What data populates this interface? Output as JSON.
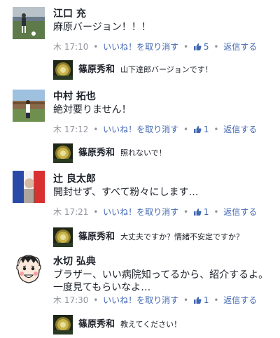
{
  "ui": {
    "link_color": "#4267b2",
    "meta_color": "#90949c",
    "like_icon": "thumbs-up-icon"
  },
  "comments": [
    {
      "author": "江口 充",
      "text_lines": [
        "麻原バージョン！！！"
      ],
      "day": "木",
      "time": "17:10",
      "unlike_label": "いいね！を取り消す",
      "like_count": "5",
      "reply_label": "返信する",
      "reply": {
        "author": "篠原秀和",
        "text": "山下達郎バージョンです！"
      }
    },
    {
      "author": "中村 拓也",
      "text_lines": [
        "絶対要りません！"
      ],
      "day": "木",
      "time": "17:12",
      "unlike_label": "いいね！を取り消す",
      "like_count": "1",
      "reply_label": "返信する",
      "reply": {
        "author": "篠原秀和",
        "text": "照れないで！"
      }
    },
    {
      "author": "辻 良太郎",
      "text_lines": [
        "開封せず、すべて粉々にします…"
      ],
      "day": "木",
      "time": "17:21",
      "unlike_label": "いいね！を取り消す",
      "like_count": "1",
      "reply_label": "返信する",
      "reply": {
        "author": "篠原秀和",
        "text": "大丈夫ですか？情緒不安定ですか？"
      }
    },
    {
      "author": "水切 弘典",
      "text_lines": [
        "ブラザー、いい病院知ってるから、紹介するよ。",
        "一度見てもらいなよ…"
      ],
      "day": "木",
      "time": "17:30",
      "unlike_label": "いいね！を取り消す",
      "like_count": "1",
      "reply_label": "返信する",
      "reply": {
        "author": "篠原秀和",
        "text": "教えてください！"
      }
    }
  ]
}
